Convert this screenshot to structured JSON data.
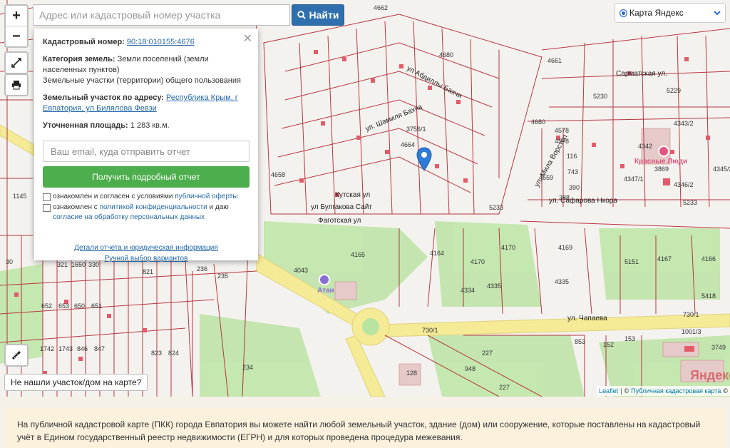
{
  "search": {
    "placeholder": "Адрес или кадастровый номер участка",
    "button_label": "Найти"
  },
  "zoom": {
    "in": "+",
    "out": "−"
  },
  "layer_select": {
    "selected": "Карта Яндекс"
  },
  "popup": {
    "cadastral_label": "Кадастровый номер:",
    "cadastral_value": "90:18:010155:4676",
    "category_label": "Категория земель:",
    "category_value": "Земли поселений (земли населенных пунктов)",
    "use_value": "Земельные участки (территории) общего пользования",
    "address_label": "Земельный участок по адресу:",
    "address_value": "Республика Крым, г Евпатория, ул Билялова Февзи",
    "area_label": "Уточненная площадь:",
    "area_value": "1 283 кв.м.",
    "email_placeholder": "Ваш email, куда отправить отчет",
    "report_button": "Получить подробный отчет",
    "consent1_text": "ознакомлен и согласен с условиями",
    "consent1_link": "публичной оферты",
    "consent2_text": "ознакомлен с",
    "consent2_link": "политикой конфиденциальности",
    "consent2_tail": "и даю",
    "consent2_link2": "согласие на обработку персональных данных",
    "details_link": "Детали отчета и юридическая информация",
    "manual_link": "Ручной выбор вариантов"
  },
  "not_found_label": "Не нашли участок/дом на карте?",
  "attribution": {
    "leaflet": "Leaflet",
    "sep": "|",
    "pkk": "Публичная кадастровая карта",
    "copy": "©"
  },
  "footer_text": "На публичной кадастровой карте (ПКК) города Евпатория вы можете найти любой земельный участок, здание (дом) или сооружение, которые поставлены на кадастровый учёт в Едином государственный реестр недвижимости (ЕГРН) и для которых проведена процедура межевания.",
  "map_labels": {
    "l1": "4680",
    "l2": "4680",
    "l3": "4661",
    "l4": "5230",
    "l5": "5229",
    "l6": "4578",
    "l7": "4578",
    "l8": "4342",
    "l9": "4343/2",
    "l10": "3869",
    "l11": "4346/2",
    "l12": "4345/2",
    "l13": "4347/1",
    "l14": "5233",
    "l15": "5233",
    "l16": "4664",
    "l17": "4658",
    "l18": "1145",
    "l19": "4165",
    "l20": "4164",
    "l21": "4170",
    "l22": "4169",
    "l23": "5151",
    "l24": "4167",
    "l25": "4166",
    "l26": "4043",
    "l27": "4170",
    "l28": "4335",
    "l29": "4334",
    "l30": "4335",
    "l31": "5418",
    "l32": "730/1",
    "l33": "730/1",
    "l34": "1001/3",
    "l35": "3749",
    "l36": "227",
    "l37": "227",
    "l38": "948",
    "l39": "128",
    "l40": "234",
    "l41": "823",
    "l42": "824",
    "l43": "821",
    "l44": "235",
    "l45": "236",
    "l46": "652",
    "l47": "653",
    "l48": "650",
    "l49": "651",
    "l50": "1742",
    "l51": "1743",
    "l52": "846",
    "l53": "847",
    "l54": "321",
    "l55": "1650",
    "l56": "330",
    "l57": "30",
    "l58": "853",
    "l59": "152",
    "l60": "153",
    "l61": "743",
    "l62": "390",
    "l63": "388",
    "l64": "116",
    "l65": "3756/1",
    "l66": "4662",
    "l67": "4659"
  },
  "streets": {
    "s1": "ул. Чапаева",
    "s2": "ул. Сафарова Нкора",
    "s3": "ул Булгакова Сайт",
    "s4": "ул Абдиллы Бахчи",
    "s5": "ул. Шамиля Бахча",
    "s6": "Сарматская ул.",
    "s7": "Кутская ул",
    "s8": "ул. Мила Ворстеп",
    "s9": "Фаготская ул"
  },
  "pois": {
    "atan": "Атан",
    "krasnye": "Красные Люди",
    "yandex_mark": "Яндекс"
  },
  "colors": {
    "parcel": "#b3232f",
    "green": "#a8d98a",
    "road": "#f6ec9e",
    "accent": "#2f6fad",
    "report": "#4cae4c"
  }
}
